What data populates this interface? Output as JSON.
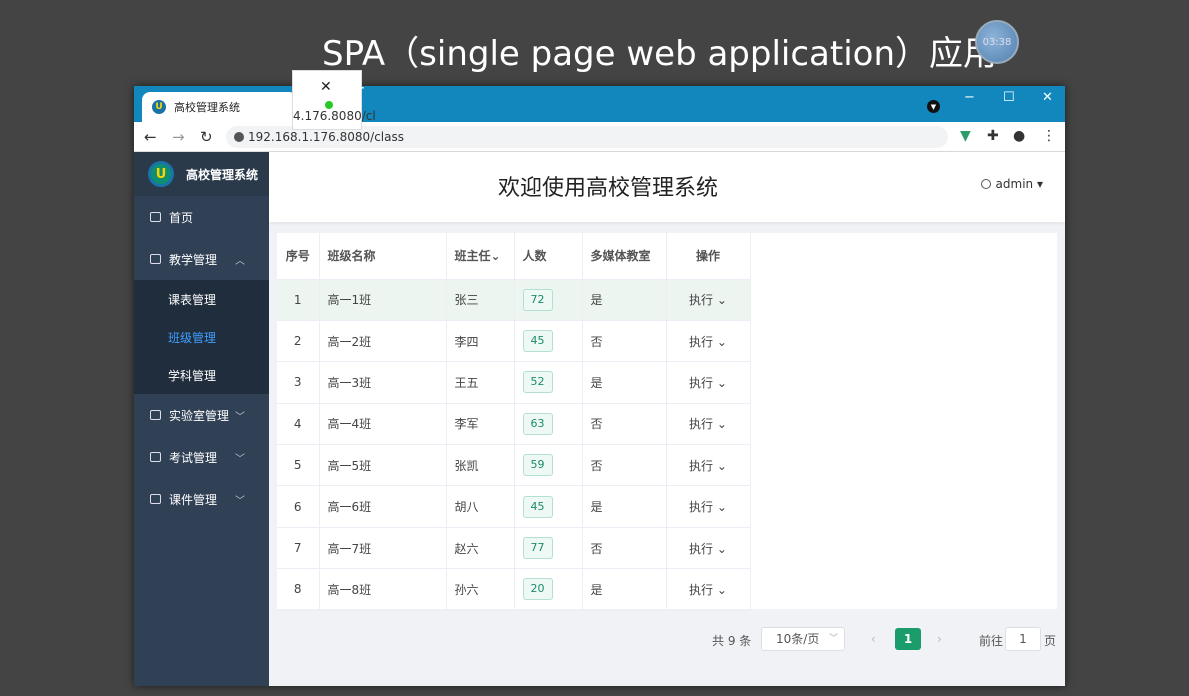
{
  "slide_title": "SPA（single page web application）应用",
  "timer": "03:38",
  "browser": {
    "tab_title": "高校管理系统",
    "url": "192.168.1.176.8080/class",
    "tooltip_url": "4.176.8080/cl",
    "controls": {
      "minimize": "−",
      "maximize": "☐",
      "close": "✕",
      "new_tab": "+"
    }
  },
  "sidebar": {
    "logo_text": "高校管理系统",
    "items": [
      {
        "label": "首页"
      },
      {
        "label": "教学管理",
        "expanded": true,
        "children": [
          {
            "label": "课表管理"
          },
          {
            "label": "班级管理",
            "active": true
          },
          {
            "label": "学科管理"
          }
        ]
      },
      {
        "label": "实验室管理"
      },
      {
        "label": "考试管理"
      },
      {
        "label": "课件管理"
      }
    ]
  },
  "header": {
    "welcome": "欢迎使用高校管理系统",
    "user": "admin"
  },
  "table": {
    "headers": [
      "序号",
      "班级名称",
      "班主任",
      "人数",
      "多媒体教室",
      "操作"
    ],
    "action_label": "执行",
    "rows": [
      {
        "no": "1",
        "name": "高一1班",
        "teacher": "张三",
        "count": "72",
        "media": "是"
      },
      {
        "no": "2",
        "name": "高一2班",
        "teacher": "李四",
        "count": "45",
        "media": "否"
      },
      {
        "no": "3",
        "name": "高一3班",
        "teacher": "王五",
        "count": "52",
        "media": "是"
      },
      {
        "no": "4",
        "name": "高一4班",
        "teacher": "李军",
        "count": "63",
        "media": "否"
      },
      {
        "no": "5",
        "name": "高一5班",
        "teacher": "张凯",
        "count": "59",
        "media": "否"
      },
      {
        "no": "6",
        "name": "高一6班",
        "teacher": "胡八",
        "count": "45",
        "media": "是"
      },
      {
        "no": "7",
        "name": "高一7班",
        "teacher": "赵六",
        "count": "77",
        "media": "否"
      },
      {
        "no": "8",
        "name": "高一8班",
        "teacher": "孙六",
        "count": "20",
        "media": "是"
      }
    ]
  },
  "pagination": {
    "total": "共 9 条",
    "page_size": "10条/页",
    "current": "1",
    "goto_label": "前往",
    "goto_value": "1",
    "page_suffix": "页"
  }
}
